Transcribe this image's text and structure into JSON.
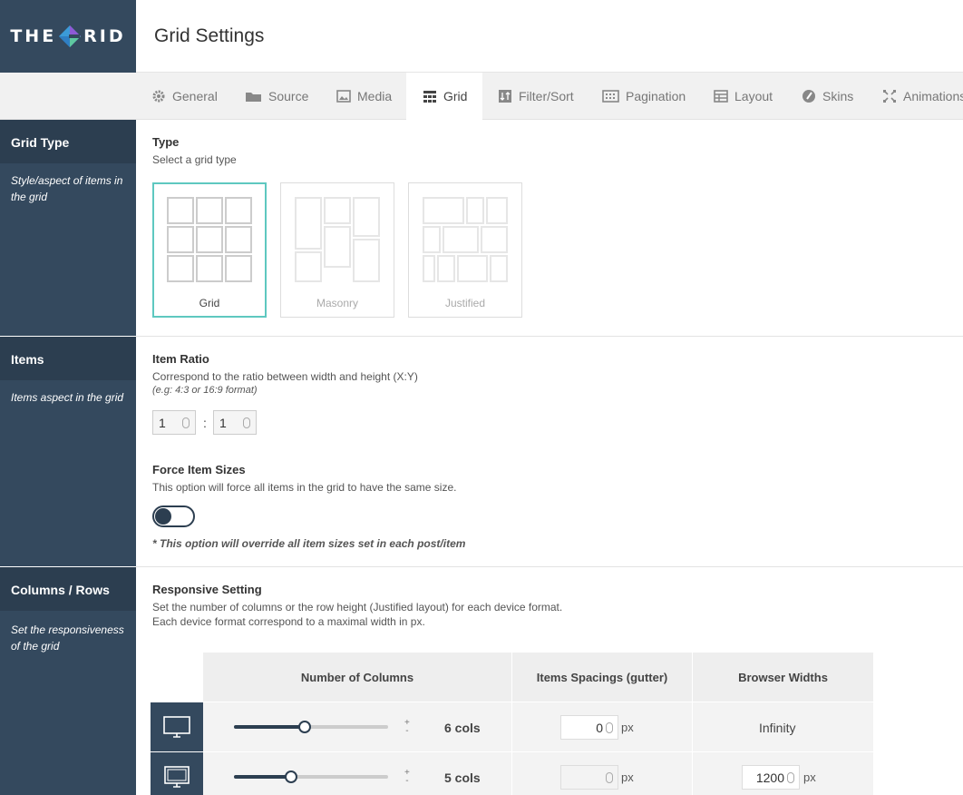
{
  "brand": {
    "logo_left": "THE",
    "logo_right": "RID"
  },
  "header": {
    "title": "Grid Settings"
  },
  "tabs": [
    {
      "label": "General",
      "icon": "gear-icon"
    },
    {
      "label": "Source",
      "icon": "folder-icon"
    },
    {
      "label": "Media",
      "icon": "image-icon"
    },
    {
      "label": "Grid",
      "icon": "grid-icon",
      "active": true
    },
    {
      "label": "Filter/Sort",
      "icon": "sort-icon"
    },
    {
      "label": "Pagination",
      "icon": "pagination-icon"
    },
    {
      "label": "Layout",
      "icon": "layout-icon"
    },
    {
      "label": "Skins",
      "icon": "palette-icon"
    },
    {
      "label": "Animations",
      "icon": "expand-icon"
    }
  ],
  "sections": {
    "grid_type": {
      "title": "Grid Type",
      "desc": "Style/aspect of items in the grid"
    },
    "items": {
      "title": "Items",
      "desc": "Items aspect in the grid"
    },
    "columns": {
      "title": "Columns / Rows",
      "desc": "Set the responsiveness of the grid"
    }
  },
  "type": {
    "label": "Type",
    "desc": "Select a grid type",
    "options": [
      {
        "label": "Grid",
        "selected": true
      },
      {
        "label": "Masonry",
        "selected": false
      },
      {
        "label": "Justified",
        "selected": false
      }
    ]
  },
  "item_ratio": {
    "label": "Item Ratio",
    "desc": "Correspond to the ratio between width and height (X:Y)",
    "hint": "(e.g: 4:3 or 16:9 format)",
    "x": "1",
    "y": "1",
    "separator": ":"
  },
  "force_sizes": {
    "label": "Force Item Sizes",
    "desc": "This option will force all items in the grid to have the same size.",
    "enabled": false,
    "note": "* This option will override all item sizes set in each post/item"
  },
  "responsive": {
    "label": "Responsive Setting",
    "desc1": "Set the number of columns or the row height (Justified layout) for each device format.",
    "desc2": "Each device format correspond to a maximal width in px.",
    "headers": [
      "Number of Columns",
      "Items Spacings (gutter)",
      "Browser Widths"
    ],
    "rows": [
      {
        "device": "desktop-icon",
        "cols": "6 cols",
        "slider_fraction": 0.46,
        "gutter": "0",
        "gutter_unit": "px",
        "width": "Infinity",
        "width_unit": ""
      },
      {
        "device": "monitor-icon",
        "cols": "5 cols",
        "slider_fraction": 0.37,
        "gutter": "",
        "gutter_unit": "px",
        "width": "1200",
        "width_unit": "px"
      }
    ],
    "plus": "+",
    "minus": "-"
  },
  "colors": {
    "sidebar": "#34495e",
    "sidebar_head": "#2c3e50",
    "accent": "#5ec8c0"
  }
}
